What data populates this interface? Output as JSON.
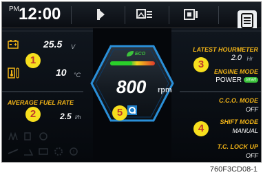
{
  "status": {
    "ampm": "PM",
    "time": "12:00"
  },
  "left": {
    "battery_value": "25.5",
    "battery_unit": "V",
    "coolant_value": "10",
    "coolant_unit": "°C",
    "fuel_rate_label": "AVERAGE FUEL RATE",
    "fuel_rate_value": "2.5",
    "fuel_rate_unit": "l/h"
  },
  "center": {
    "eco_label": "ECO",
    "rpm_value": "800",
    "rpm_unit": "rpm"
  },
  "right": {
    "hourmeter_label": "LATEST HOURMETER",
    "hourmeter_value": "2.0",
    "hourmeter_unit": "Hr",
    "engine_mode_label": "ENGINE MODE",
    "engine_mode_value": "POWER",
    "smart_badge": "smart",
    "cco_label": "C.C.O. MODE",
    "cco_value": "OFF",
    "shift_label": "SHIFT MODE",
    "shift_value": "MANUAL",
    "tc_label": "T.C. LOCK UP",
    "tc_value": "OFF"
  },
  "callouts": {
    "one": "1",
    "two": "2",
    "three": "3",
    "four": "4",
    "five": "5"
  },
  "caption": "760F3CD08-1",
  "colors": {
    "accent_yellow": "#f2b417",
    "eco_green": "#3cc43c",
    "hex_blue": "#2a8fd8",
    "badge_yellow": "#f7df1e"
  }
}
